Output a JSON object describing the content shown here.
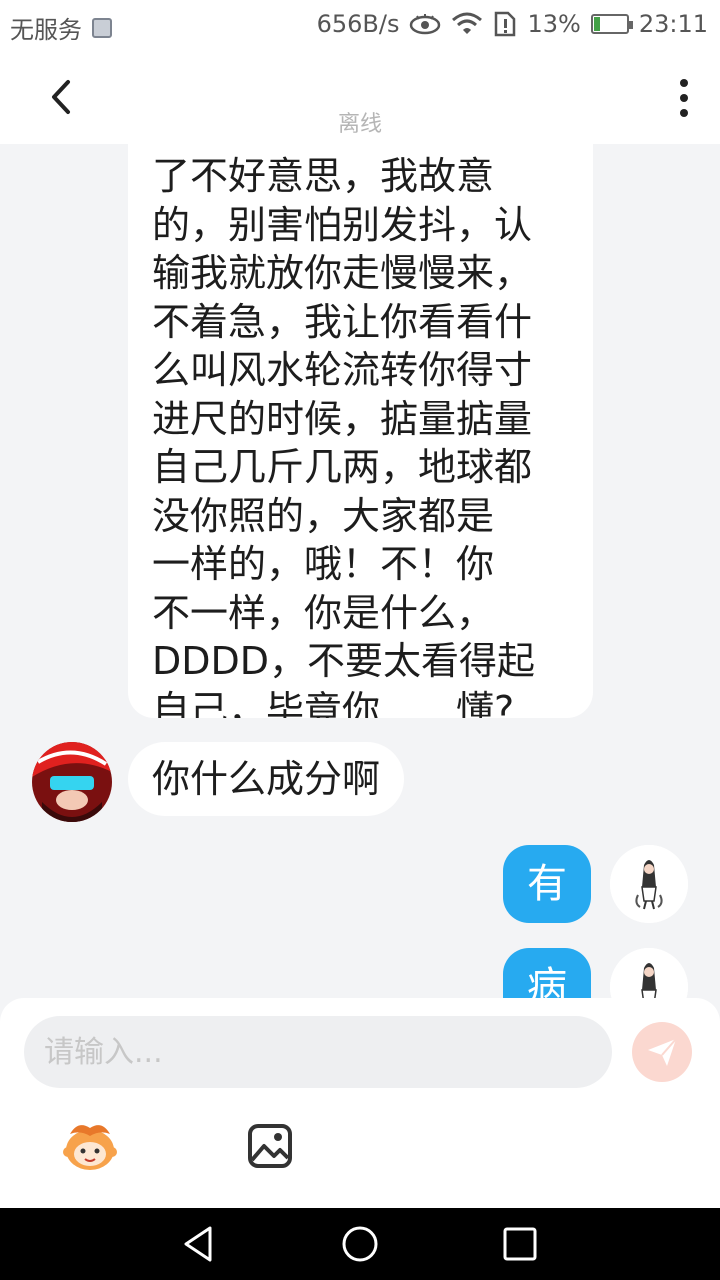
{
  "status_bar": {
    "carrier": "无服务",
    "speed": "656B/s",
    "battery": "13%",
    "time": "23:11"
  },
  "header": {
    "status": "离线"
  },
  "messages": {
    "long_text": "了不好意思，我故意\n的，别害怕别发抖，认\n输我就放你走慢慢来，\n不着急，我让你看看什\n么叫风水轮流转你得寸\n进尺的时候，掂量掂量\n自己几斤几两，地球都\n没你照的，大家都是\n一样的，哦！不！你\n不一样，你是什么，\nDDDD，不要太看得起\n自己，毕竟你……懂?",
    "incoming_short": "你什么成分啊",
    "outgoing_1": "有",
    "outgoing_2": "病"
  },
  "input": {
    "placeholder": "请输入..."
  },
  "colors": {
    "accent_blue": "#27aaf0",
    "send_button": "#fbd8d0",
    "background": "#f3f4f6"
  },
  "icons": {
    "back": "chevron-left-icon",
    "more": "more-vertical-icon",
    "send": "paper-plane-icon",
    "emoji": "emoji-face-icon",
    "image": "image-icon"
  }
}
